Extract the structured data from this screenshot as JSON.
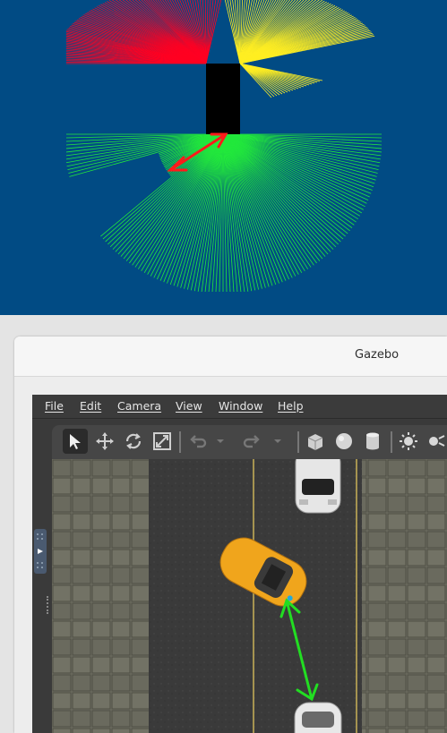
{
  "window": {
    "title": "Gazebo"
  },
  "menu": [
    "File",
    "Edit",
    "Camera",
    "View",
    "Window",
    "Help"
  ],
  "toolbar": {
    "tools": [
      "select-arrow-icon",
      "translate-icon",
      "rotate-icon",
      "scale-icon",
      "undo-icon",
      "undo-dropdown-icon",
      "redo-icon",
      "redo-dropdown-icon",
      "box-shape-icon",
      "sphere-shape-icon",
      "cylinder-shape-icon",
      "sun-light-icon",
      "point-light-icon"
    ]
  },
  "colors": {
    "rviz_background": "#014b84",
    "laser_red": "#ff0022",
    "laser_yellow": "#ffee22",
    "laser_green": "#22e83c",
    "measure_red": "#ff1a1a",
    "measure_green": "#22dd22",
    "ego_car": "#f0a51c"
  }
}
